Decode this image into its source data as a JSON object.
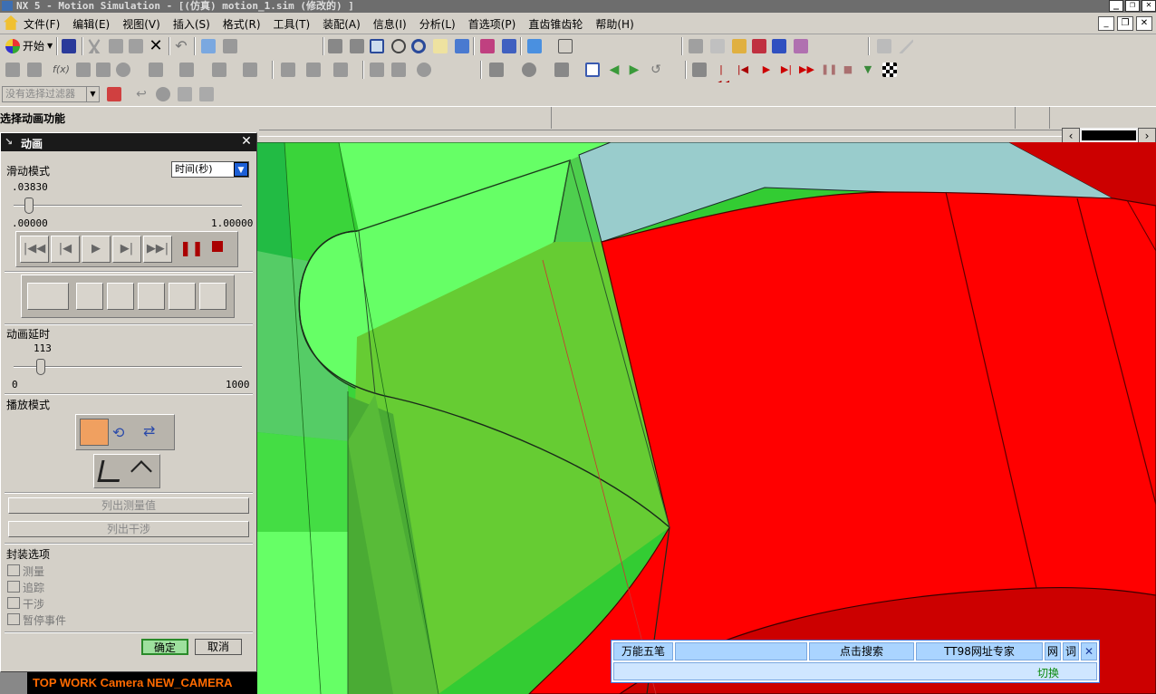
{
  "window": {
    "title": "NX 5 - Motion Simulation - [(仿真) motion_1.sim (修改的) ]"
  },
  "menubar": {
    "items": [
      "文件(F)",
      "编辑(E)",
      "视图(V)",
      "插入(S)",
      "格式(R)",
      "工具(T)",
      "装配(A)",
      "信息(I)",
      "分析(L)",
      "首选项(P)",
      "直齿锥齿轮",
      "帮助(H)"
    ]
  },
  "toolbar": {
    "start_label": "开始",
    "filter_placeholder": "没有选择过滤器"
  },
  "cue_line": {
    "text": "选择动画功能"
  },
  "dialog": {
    "title": "动画",
    "slide_mode_label": "滑动模式",
    "slide_mode_value": "时间(秒)",
    "time_value": ".03830",
    "time_min": ".00000",
    "time_max": "1.00000",
    "time_fraction": 0.0383,
    "delay_label": "动画延时",
    "delay_value": "113",
    "delay_min": "0",
    "delay_max": "1000",
    "delay_fraction": 0.113,
    "play_mode_label": "播放模式",
    "list_measure": "列出测量值",
    "list_interference": "列出干涉",
    "package_options_label": "封装选项",
    "package_options": [
      "测量",
      "追踪",
      "干涉",
      "暂停事件"
    ],
    "ok": "确定",
    "cancel": "取消"
  },
  "status": {
    "text": "TOP WORK Camera NEW_CAMERA"
  },
  "ime": {
    "input_method": "万能五笔",
    "search": "点击搜索",
    "site": "TT98网址专家",
    "web": "网",
    "word": "词",
    "close": "✕",
    "switch": "切换"
  },
  "colors": {
    "viewport_green": "#33cc33",
    "light_green": "#66ff66",
    "olive_green": "#66cc33",
    "red": "#ff0000",
    "teal": "#99cccc",
    "status_orange": "#ff6a00"
  }
}
